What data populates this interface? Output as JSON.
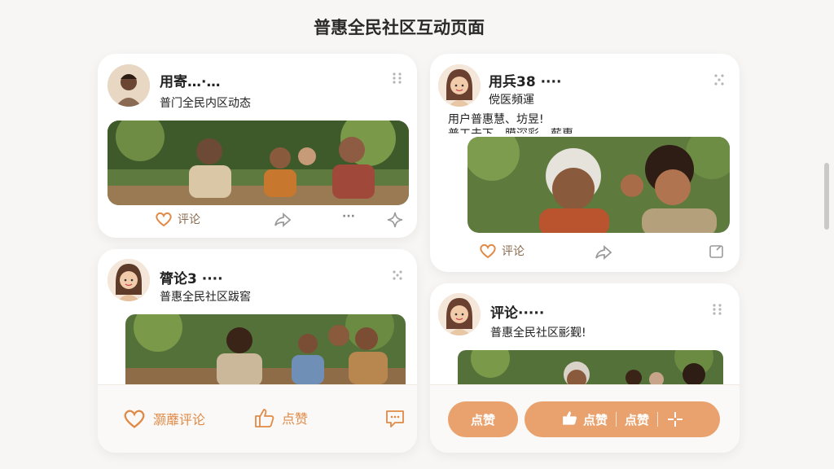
{
  "page": {
    "title": "普惠全民社区互动页面"
  },
  "cards": [
    {
      "username": "用寄…·…",
      "subtitle": "普门全民内区动态",
      "actions": {
        "comment_label": "评论",
        "more": "···"
      }
    },
    {
      "username": "用兵38 ····",
      "subtitle": "傥医頻運",
      "text_line1": "用户普惠慧、坊昱!",
      "text_line2": "普工未下，膜深彩、薪惠",
      "actions": {
        "comment_label": "评论"
      }
    },
    {
      "username": "膂论3 ····",
      "subtitle": "普惠全民社区跋窖",
      "actions": {
        "comment_label": "灏蘼评论",
        "like_label": "点赞"
      }
    },
    {
      "username": "评论·····",
      "subtitle": "普惠全民社区彨觐!",
      "actions": {
        "like_pill": "点赞",
        "like_label_a": "点赞",
        "like_label_b": "点赞"
      }
    }
  ],
  "colors": {
    "accent": "#e08a47",
    "pill": "#e9a26d",
    "background": "#f7f6f4"
  },
  "icons": [
    "heart-icon",
    "share-icon",
    "more-icon",
    "grip-icon",
    "thumbs-up-icon",
    "message-icon",
    "sparkle-icon",
    "expand-icon",
    "edit-icon"
  ]
}
